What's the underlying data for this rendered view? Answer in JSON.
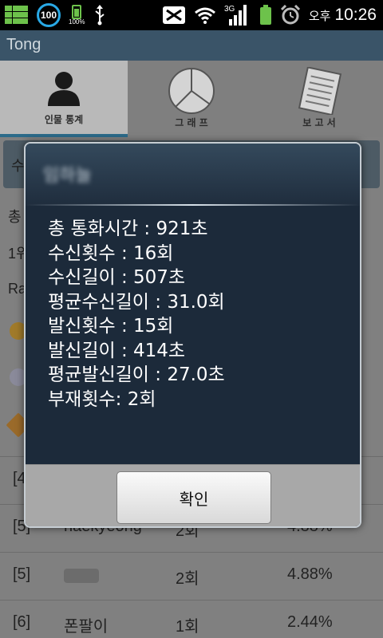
{
  "status_bar": {
    "battery_percent_label": "100%",
    "badge_count": "100",
    "ampm": "오후",
    "time": "10:26",
    "network_label": "3G",
    "icons": [
      "app-grid-icon",
      "notification-badge-icon",
      "battery-small-icon",
      "usb-icon",
      "no-sim-icon",
      "wifi-icon",
      "signal-icon",
      "battery-icon",
      "alarm-icon"
    ]
  },
  "app": {
    "title": "Tong"
  },
  "tabs": [
    {
      "label": "인물 통계",
      "icon": "person-icon",
      "active": true
    },
    {
      "label": "그 래 프",
      "icon": "pie-chart-icon",
      "active": false
    },
    {
      "label": "보 고 서",
      "icon": "report-icon",
      "active": false
    }
  ],
  "background": {
    "fragments": [
      "수",
      "총",
      "1위",
      "Ra"
    ],
    "rows": [
      {
        "rank": "[4]",
        "name": "",
        "count": "",
        "percent": ""
      },
      {
        "rank": "[5]",
        "name": "haekyeong",
        "count": "2회",
        "percent": "4.88%"
      },
      {
        "rank": "[5]",
        "name": "",
        "count": "2회",
        "percent": "4.88%"
      },
      {
        "rank": "[6]",
        "name": "폰팔이",
        "count": "1회",
        "percent": "2.44%"
      }
    ]
  },
  "dialog": {
    "title": "임하늘",
    "lines": [
      "총 통화시간 : 921초",
      "수신횟수 : 16회",
      "수신길이 : 507초",
      "평균수신길이 : 31.0회",
      "발신횟수 : 15회",
      "발신길이 : 414초",
      "평균발신길이 : 27.0초",
      "부재횟수: 2회"
    ],
    "ok_label": "확인"
  },
  "colors": {
    "title_bar": "#3a5468",
    "dialog_body": "#1c2a3a",
    "accent_blue": "#29a9e6",
    "status_green": "#6dc24b"
  }
}
